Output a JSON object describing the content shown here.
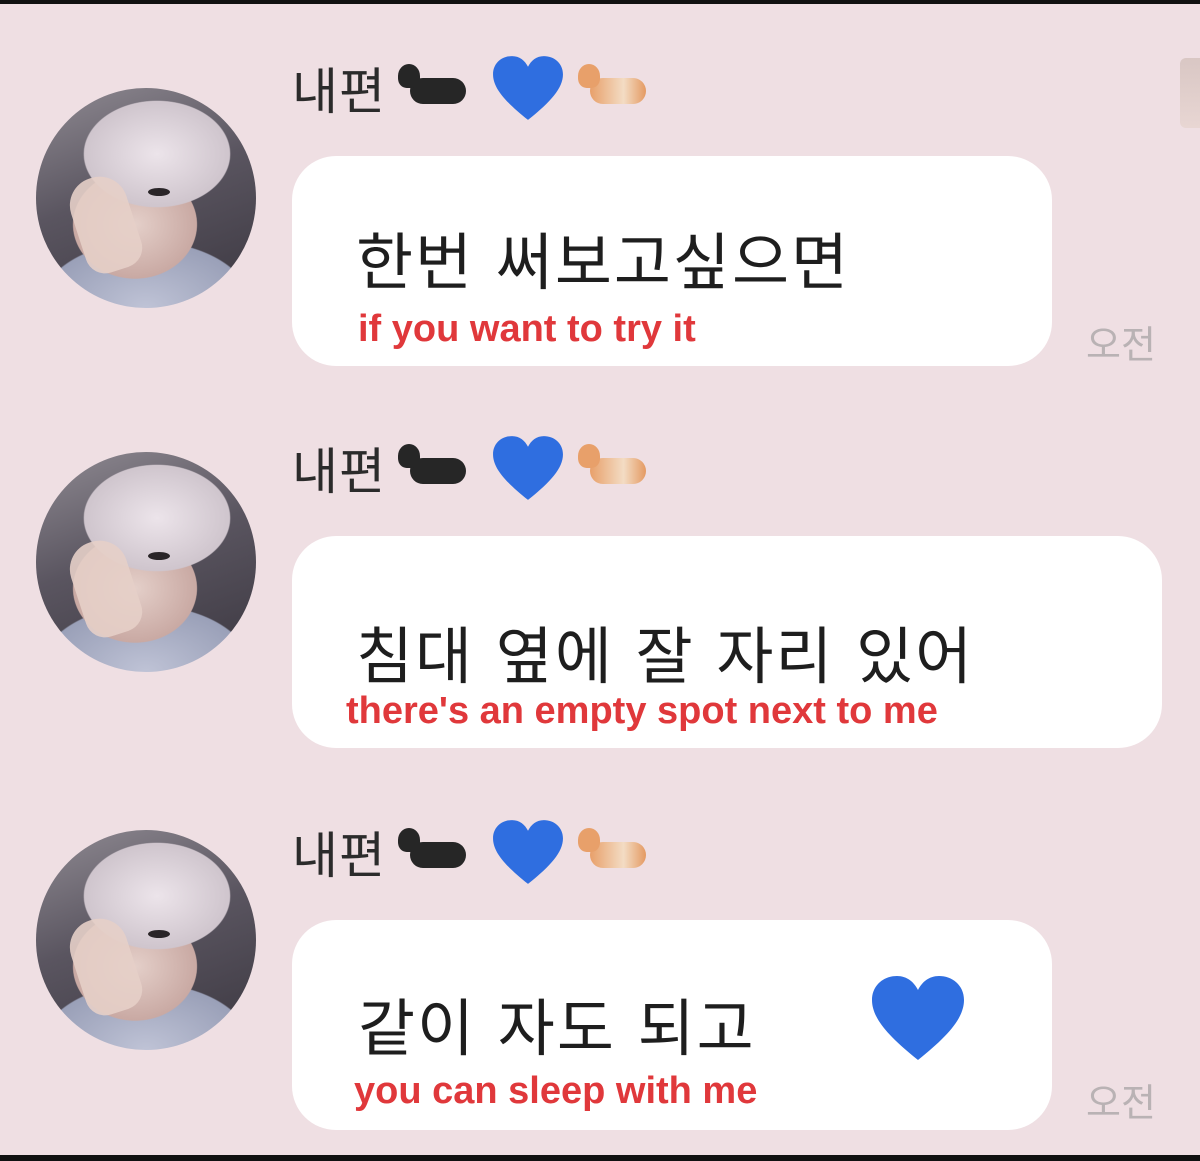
{
  "chat": {
    "messages": [
      {
        "sender": "내편",
        "text": "한번 써보고싶으면",
        "caption": "if you want to try it",
        "time": "오전"
      },
      {
        "sender": "내편",
        "text": "침대 옆에 잘 자리 있어",
        "caption": "there's an empty spot next to me",
        "time": ""
      },
      {
        "sender": "내편",
        "text": "같이 자도 되고",
        "caption": "you can sleep with me",
        "time": "오전"
      }
    ]
  },
  "icons": {
    "sender_emojis": [
      "black-cat-icon",
      "blue-heart-icon",
      "orange-cat-icon"
    ],
    "heart_color": "#2f6ee0"
  },
  "colors": {
    "background": "#efdfe3",
    "bubble": "#ffffff",
    "caption": "#e0383b",
    "time": "#b9b2b4"
  }
}
